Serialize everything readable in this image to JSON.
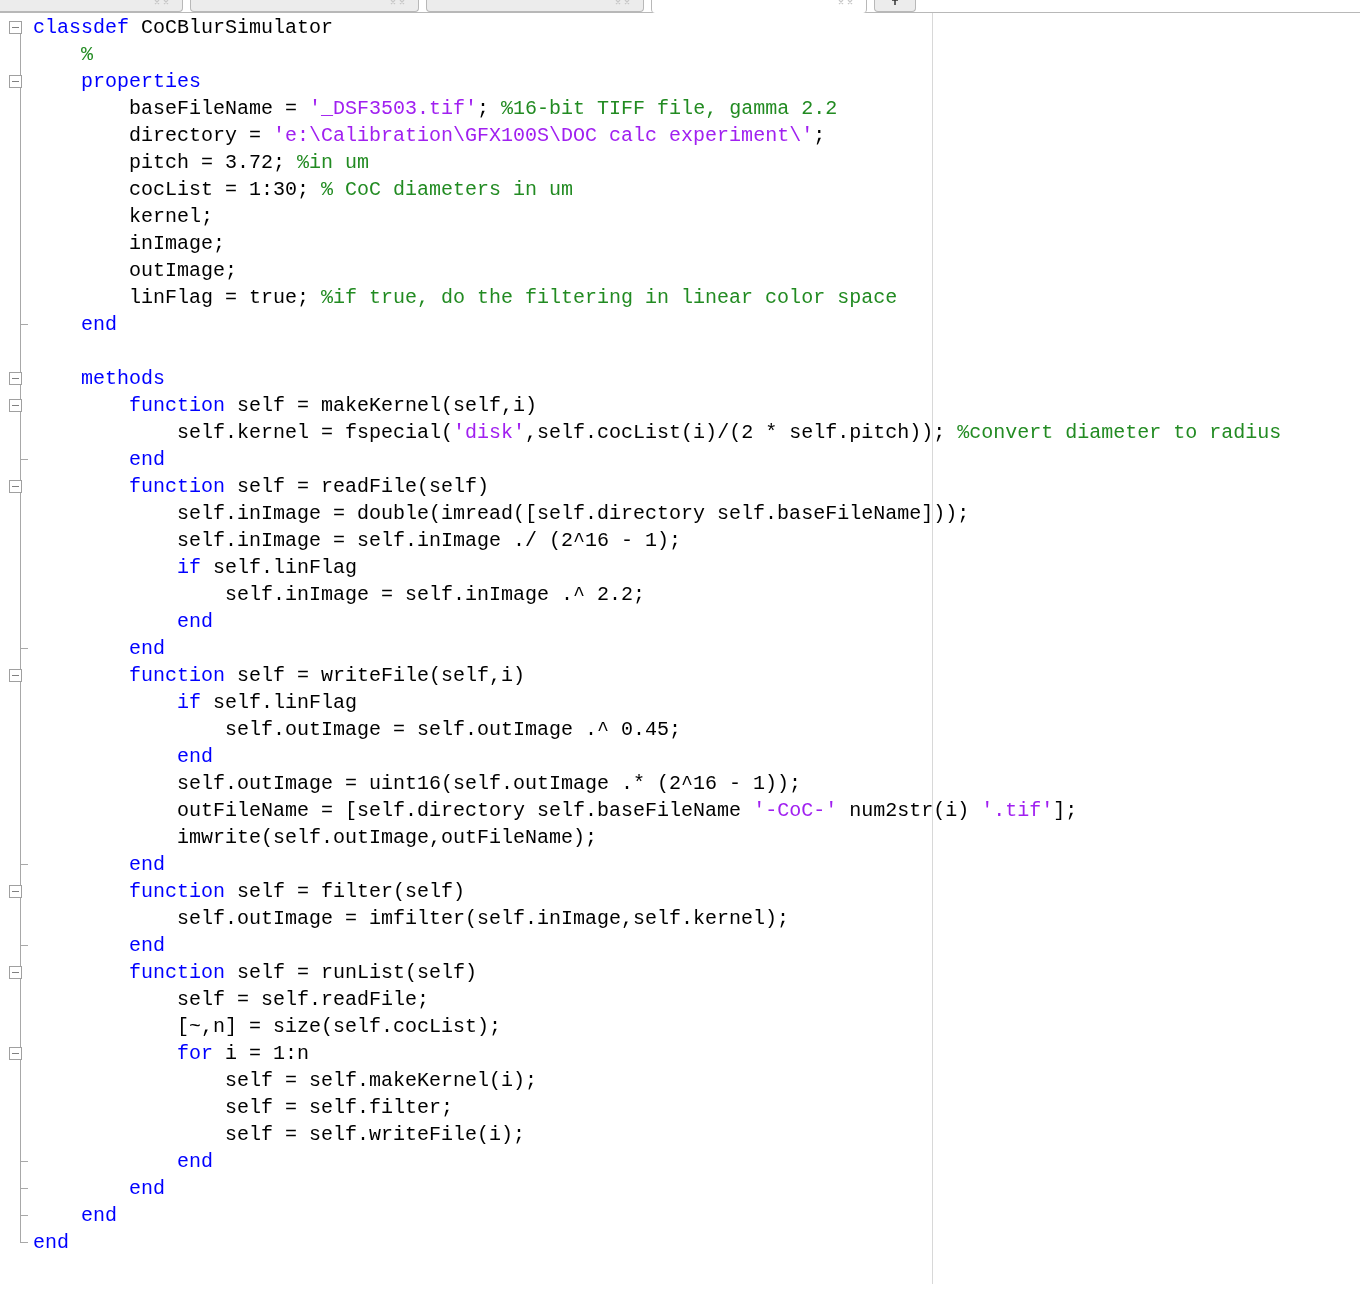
{
  "tabs": [
    {
      "selected": false
    },
    {
      "selected": false
    },
    {
      "selected": false
    },
    {
      "selected": true
    }
  ],
  "lines": [
    {
      "kind": "fold_start",
      "segs": [
        {
          "kind": "k",
          "text": "classdef"
        },
        {
          "kind": "p",
          "text": " CoCBlurSimulator"
        }
      ]
    },
    {
      "kind": "plain",
      "segs": [
        {
          "kind": "c",
          "text": "    %"
        }
      ]
    },
    {
      "kind": "fold_start",
      "segs": [
        {
          "kind": "k",
          "text": "    properties"
        }
      ]
    },
    {
      "kind": "plain",
      "segs": [
        {
          "kind": "p",
          "text": "        baseFileName = "
        },
        {
          "kind": "s",
          "text": "'_DSF3503.tif'"
        },
        {
          "kind": "p",
          "text": "; "
        },
        {
          "kind": "c",
          "text": "%16-bit TIFF file, gamma 2.2"
        }
      ]
    },
    {
      "kind": "plain",
      "segs": [
        {
          "kind": "p",
          "text": "        directory = "
        },
        {
          "kind": "s",
          "text": "'e:\\Calibration\\GFX100S\\DOC calc experiment\\'"
        },
        {
          "kind": "p",
          "text": ";"
        }
      ]
    },
    {
      "kind": "plain",
      "segs": [
        {
          "kind": "p",
          "text": "        pitch = 3.72; "
        },
        {
          "kind": "c",
          "text": "%in um"
        }
      ]
    },
    {
      "kind": "plain",
      "segs": [
        {
          "kind": "p",
          "text": "        cocList = 1:30; "
        },
        {
          "kind": "c",
          "text": "% CoC diameters in um"
        }
      ]
    },
    {
      "kind": "plain",
      "segs": [
        {
          "kind": "p",
          "text": "        kernel;"
        }
      ]
    },
    {
      "kind": "plain",
      "segs": [
        {
          "kind": "p",
          "text": "        inImage;"
        }
      ]
    },
    {
      "kind": "plain",
      "segs": [
        {
          "kind": "p",
          "text": "        outImage;"
        }
      ]
    },
    {
      "kind": "plain",
      "segs": [
        {
          "kind": "p",
          "text": "        linFlag = true; "
        },
        {
          "kind": "c",
          "text": "%if true, do the filtering in linear color space"
        }
      ]
    },
    {
      "kind": "fold_end",
      "segs": [
        {
          "kind": "k",
          "text": "    end"
        }
      ]
    },
    {
      "kind": "blank"
    },
    {
      "kind": "fold_start",
      "segs": [
        {
          "kind": "k",
          "text": "    methods"
        }
      ]
    },
    {
      "kind": "fold_start",
      "segs": [
        {
          "kind": "k",
          "text": "        function"
        },
        {
          "kind": "p",
          "text": " self = makeKernel(self,i)"
        }
      ]
    },
    {
      "kind": "plain",
      "segs": [
        {
          "kind": "p",
          "text": "            self.kernel = fspecial("
        },
        {
          "kind": "s",
          "text": "'disk'"
        },
        {
          "kind": "p",
          "text": ",self.cocList(i)/(2 * self.pitch)); "
        },
        {
          "kind": "c",
          "text": "%convert diameter to radius"
        }
      ]
    },
    {
      "kind": "fold_end",
      "segs": [
        {
          "kind": "k",
          "text": "        end"
        }
      ]
    },
    {
      "kind": "fold_start",
      "segs": [
        {
          "kind": "k",
          "text": "        function"
        },
        {
          "kind": "p",
          "text": " self = readFile(self)"
        }
      ]
    },
    {
      "kind": "plain",
      "segs": [
        {
          "kind": "p",
          "text": "            self.inImage = double(imread([self.directory self.baseFileName]));"
        }
      ]
    },
    {
      "kind": "plain",
      "segs": [
        {
          "kind": "p",
          "text": "            self.inImage = self.inImage ./ (2^16 - 1);"
        }
      ]
    },
    {
      "kind": "plain",
      "segs": [
        {
          "kind": "k",
          "text": "            if"
        },
        {
          "kind": "p",
          "text": " self.linFlag"
        }
      ]
    },
    {
      "kind": "plain",
      "segs": [
        {
          "kind": "p",
          "text": "                self.inImage = self.inImage .^ 2.2;"
        }
      ]
    },
    {
      "kind": "plain",
      "segs": [
        {
          "kind": "k",
          "text": "            end"
        }
      ]
    },
    {
      "kind": "fold_end",
      "segs": [
        {
          "kind": "k",
          "text": "        end"
        }
      ]
    },
    {
      "kind": "fold_start",
      "segs": [
        {
          "kind": "k",
          "text": "        function"
        },
        {
          "kind": "p",
          "text": " self = writeFile(self,i)"
        }
      ]
    },
    {
      "kind": "plain",
      "segs": [
        {
          "kind": "k",
          "text": "            if"
        },
        {
          "kind": "p",
          "text": " self.linFlag"
        }
      ]
    },
    {
      "kind": "plain",
      "segs": [
        {
          "kind": "p",
          "text": "                self.outImage = self.outImage .^ 0.45;"
        }
      ]
    },
    {
      "kind": "plain",
      "segs": [
        {
          "kind": "k",
          "text": "            end"
        }
      ]
    },
    {
      "kind": "plain",
      "segs": [
        {
          "kind": "p",
          "text": "            self.outImage = uint16(self.outImage .* (2^16 - 1));"
        }
      ]
    },
    {
      "kind": "plain",
      "segs": [
        {
          "kind": "p",
          "text": "            outFileName = [self.directory self.baseFileName "
        },
        {
          "kind": "s",
          "text": "'-CoC-'"
        },
        {
          "kind": "p",
          "text": " num2str(i) "
        },
        {
          "kind": "s",
          "text": "'.tif'"
        },
        {
          "kind": "p",
          "text": "];"
        }
      ]
    },
    {
      "kind": "plain",
      "segs": [
        {
          "kind": "p",
          "text": "            imwrite(self.outImage,outFileName);"
        }
      ]
    },
    {
      "kind": "fold_end",
      "segs": [
        {
          "kind": "k",
          "text": "        end"
        }
      ]
    },
    {
      "kind": "fold_start",
      "segs": [
        {
          "kind": "k",
          "text": "        function"
        },
        {
          "kind": "p",
          "text": " self = filter(self)"
        }
      ]
    },
    {
      "kind": "plain",
      "segs": [
        {
          "kind": "p",
          "text": "            self.outImage = imfilter(self.inImage,self.kernel);"
        }
      ]
    },
    {
      "kind": "fold_end",
      "segs": [
        {
          "kind": "k",
          "text": "        end"
        }
      ]
    },
    {
      "kind": "fold_start",
      "segs": [
        {
          "kind": "k",
          "text": "        function"
        },
        {
          "kind": "p",
          "text": " self = runList(self)"
        }
      ]
    },
    {
      "kind": "plain",
      "segs": [
        {
          "kind": "p",
          "text": "            self = self.readFile;"
        }
      ]
    },
    {
      "kind": "plain",
      "segs": [
        {
          "kind": "p",
          "text": "            [~,n] = size(self.cocList);"
        }
      ]
    },
    {
      "kind": "fold_start",
      "segs": [
        {
          "kind": "k",
          "text": "            for"
        },
        {
          "kind": "p",
          "text": " i = 1:n"
        }
      ]
    },
    {
      "kind": "plain",
      "segs": [
        {
          "kind": "p",
          "text": "                self = self.makeKernel(i);"
        }
      ]
    },
    {
      "kind": "plain",
      "segs": [
        {
          "kind": "p",
          "text": "                self = self.filter;"
        }
      ]
    },
    {
      "kind": "plain",
      "segs": [
        {
          "kind": "p",
          "text": "                self = self.writeFile(i);"
        }
      ]
    },
    {
      "kind": "fold_end",
      "segs": [
        {
          "kind": "k",
          "text": "            end"
        }
      ]
    },
    {
      "kind": "fold_end",
      "segs": [
        {
          "kind": "k",
          "text": "        end"
        }
      ]
    },
    {
      "kind": "fold_end",
      "segs": [
        {
          "kind": "k",
          "text": "    end"
        }
      ]
    },
    {
      "kind": "fold_last",
      "segs": [
        {
          "kind": "k",
          "text": "end"
        }
      ]
    }
  ]
}
